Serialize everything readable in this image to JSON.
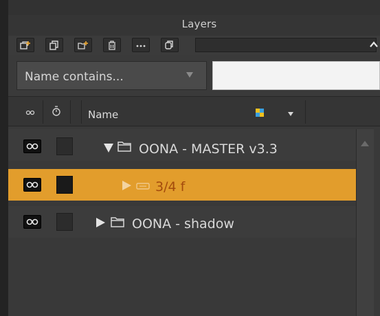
{
  "panel": {
    "title": "Layers",
    "toolbar": [
      {
        "icon": "new-layer-icon"
      },
      {
        "icon": "duplicate-layer-icon"
      },
      {
        "icon": "new-folder-icon"
      },
      {
        "icon": "trash-icon"
      },
      {
        "icon": "more-icon"
      },
      {
        "icon": "copy-layers-icon"
      }
    ],
    "collapse_icon": "chevron-up-icon"
  },
  "filter": {
    "label": "Name contains...",
    "input_value": ""
  },
  "header": {
    "visibility_icon": "eye-icon",
    "lock_icon": "timer-icon",
    "name_label": "Name",
    "color_icon": "color-swatch-icon",
    "dropdown_icon": "triangle-down-icon"
  },
  "colors": {
    "selected_row": "#e29d2c",
    "selected_text": "#a34a0c",
    "panel_bg": "#3a3a3a"
  },
  "layers": [
    {
      "label": "OONA - MASTER v3.3",
      "expanded": true,
      "type": "folder",
      "selected": false
    },
    {
      "label": "3/4 f",
      "expanded": false,
      "type": "linked-layer",
      "selected": true
    },
    {
      "label": "OONA - shadow",
      "expanded": false,
      "type": "folder",
      "selected": false
    }
  ]
}
